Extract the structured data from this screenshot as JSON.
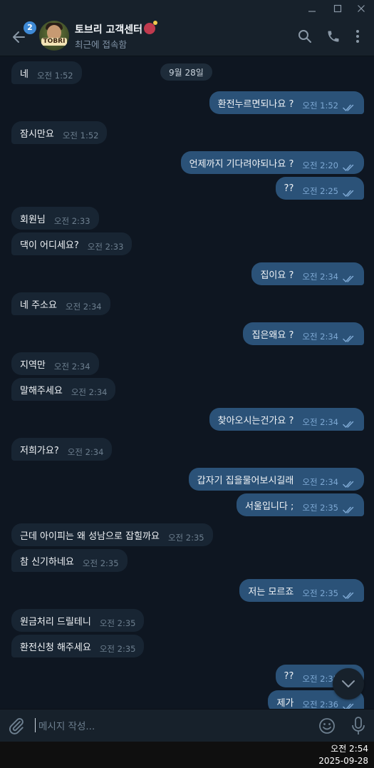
{
  "header": {
    "unread_count": "2",
    "avatar_text": "TOBRI",
    "title": "토브리 고객센터",
    "status": "최근에 접속함"
  },
  "chat": {
    "date_separator": "9월 28일",
    "messages": [
      {
        "dir": "in",
        "text": "네",
        "time": "오전 1:52"
      },
      {
        "dir": "out",
        "text": "환전누르면되나요 ?",
        "time": "오전 1:52"
      },
      {
        "dir": "in",
        "text": "잠시만요",
        "time": "오전 1:52"
      },
      {
        "dir": "out",
        "text": "언제까지 기다려야되나요 ?",
        "time": "오전 2:20"
      },
      {
        "dir": "out",
        "text": "??",
        "time": "오전 2:25"
      },
      {
        "dir": "in",
        "text": "회원님",
        "time": "오전 2:33"
      },
      {
        "dir": "in",
        "text": "댁이 어디세요?",
        "time": "오전 2:33"
      },
      {
        "dir": "out",
        "text": "집이요 ?",
        "time": "오전 2:34"
      },
      {
        "dir": "in",
        "text": "네 주소요",
        "time": "오전 2:34"
      },
      {
        "dir": "out",
        "text": "집은왜요 ?",
        "time": "오전 2:34"
      },
      {
        "dir": "in",
        "text": "지역만",
        "time": "오전 2:34"
      },
      {
        "dir": "in",
        "text": "말해주세요",
        "time": "오전 2:34"
      },
      {
        "dir": "out",
        "text": "찾아오시는건가요 ?",
        "time": "오전 2:34"
      },
      {
        "dir": "in",
        "text": "저희가요?",
        "time": "오전 2:34"
      },
      {
        "dir": "out",
        "text": "갑자기 집을물어보시길래",
        "time": "오전 2:34"
      },
      {
        "dir": "out",
        "text": "서울입니다 ;",
        "time": "오전 2:35"
      },
      {
        "dir": "in",
        "text": "근데 아이피는 왜 성남으로 잡힐까요",
        "time": "오전 2:35"
      },
      {
        "dir": "in",
        "text": "참 신기하네요",
        "time": "오전 2:35"
      },
      {
        "dir": "out",
        "text": "저는 모르죠",
        "time": "오전 2:35"
      },
      {
        "dir": "in",
        "text": "원금처리 드릴테니",
        "time": "오전 2:35"
      },
      {
        "dir": "in",
        "text": "환전신청 해주세요",
        "time": "오전 2:35"
      },
      {
        "dir": "out",
        "text": "??",
        "time": "오전 2:35"
      },
      {
        "dir": "out",
        "text": "제가",
        "time": "오전 2:36"
      }
    ]
  },
  "composer": {
    "placeholder": "메시지 작성..."
  },
  "taskbar": {
    "time": "오전 2:54",
    "date": "2025-09-28"
  },
  "colors": {
    "background": "#0e1621",
    "incoming_bubble": "#182533",
    "outgoing_bubble": "#2b5278",
    "accent": "#3e8ad6"
  }
}
